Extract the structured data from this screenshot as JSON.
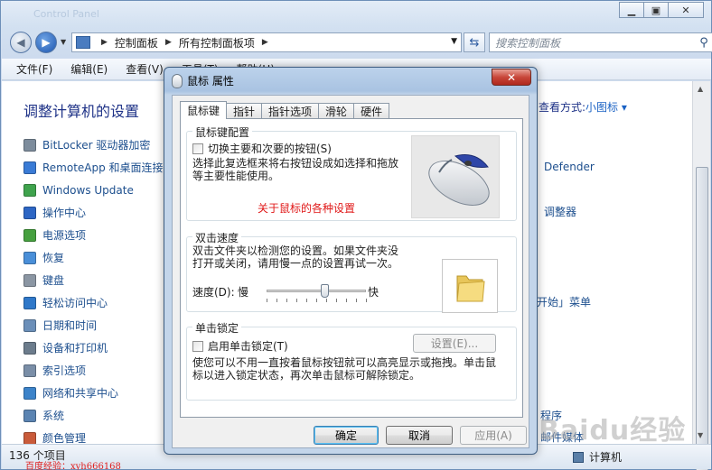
{
  "explorer": {
    "title_ghost": "Control Panel",
    "address_crumbs": [
      "控制面板",
      "所有控制面板项"
    ],
    "search_placeholder": "搜索控制面板",
    "menus": [
      "文件(F)",
      "编辑(E)",
      "查看(V)",
      "工具(T)",
      "帮助(H)"
    ],
    "page_title": "调整计算机的设置",
    "view_by_label": "查看方式:",
    "view_by_value": "小图标 ▾",
    "items": [
      {
        "label": "BitLocker 驱动器加密",
        "color": "#7d8c9c"
      },
      {
        "label": "RemoteApp 和桌面连接",
        "color": "#3a7bd5"
      },
      {
        "label": "Windows Update",
        "color": "#3fa34d"
      },
      {
        "label": "操作中心",
        "color": "#2d66c4"
      },
      {
        "label": "电源选项",
        "color": "#46a03f"
      },
      {
        "label": "恢复",
        "color": "#4a8fd8"
      },
      {
        "label": "键盘",
        "color": "#8b96a3"
      },
      {
        "label": "轻松访问中心",
        "color": "#2f78c9"
      },
      {
        "label": "日期和时间",
        "color": "#6b8fb9"
      },
      {
        "label": "设备和打印机",
        "color": "#6c7c8c"
      },
      {
        "label": "索引选项",
        "color": "#7a8ea7"
      },
      {
        "label": "网络和共享中心",
        "color": "#3c83c9"
      },
      {
        "label": "系统",
        "color": "#5b84b2"
      },
      {
        "label": "颜色管理",
        "color": "#c95b3a"
      }
    ],
    "right_fragments": [
      "Defender",
      "调整器",
      "「开始」菜单",
      "程序",
      "邮件媒体"
    ],
    "status_count": "136 个项目",
    "status_computer": "计算机",
    "watermark_user": "百度经验：xyh666168",
    "watermark_baidu": "Baidu经验"
  },
  "dialog": {
    "title": "鼠标 属性",
    "close_label": "✕",
    "tabs": [
      "鼠标键",
      "指针",
      "指针选项",
      "滑轮",
      "硬件"
    ],
    "button_config": {
      "legend": "鼠标键配置",
      "switch_label": "切换主要和次要的按钮(S)",
      "switch_checked": false,
      "description": "选择此复选框来将右按钮设成如选择和拖放等主要性能使用。",
      "link": "关于鼠标的各种设置"
    },
    "double_click": {
      "legend": "双击速度",
      "description": "双击文件夹以检测您的设置。如果文件夹没打开或关闭，请用慢一点的设置再试一次。",
      "speed_label": "速度(D):",
      "slow_label": "慢",
      "fast_label": "快",
      "speed_value": 0.58
    },
    "click_lock": {
      "legend": "单击锁定",
      "enable_label": "启用单击锁定(T)",
      "enable_checked": false,
      "settings_button": "设置(E)...",
      "description": "使您可以不用一直按着鼠标按钮就可以高亮显示或拖拽。单击鼠标以进入锁定状态，再次单击鼠标可解除锁定。"
    },
    "buttons": {
      "ok": "确定",
      "cancel": "取消",
      "apply": "应用(A)"
    },
    "colors": {
      "accent_link": "#e01818",
      "title_bar": "#a9c3e2"
    }
  }
}
